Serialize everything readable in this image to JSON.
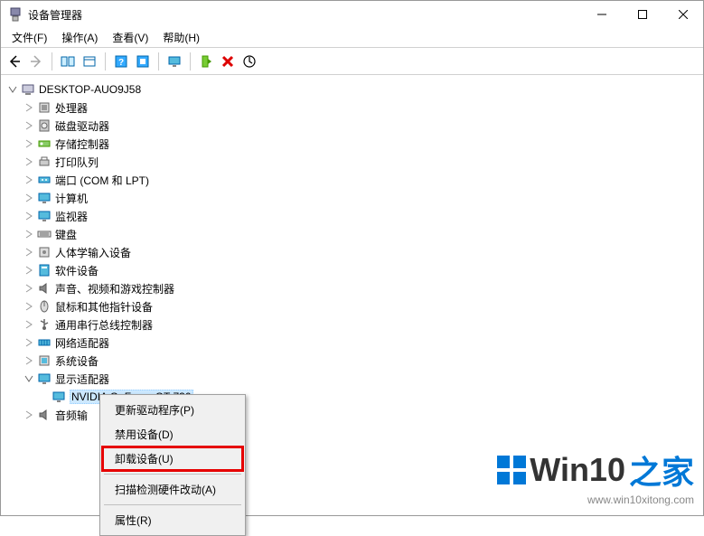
{
  "window": {
    "title": "设备管理器",
    "minimize": "–",
    "maximize": "☐",
    "close": "✕"
  },
  "menubar": {
    "file": "文件(F)",
    "action": "操作(A)",
    "view": "查看(V)",
    "help": "帮助(H)"
  },
  "toolbar_icons": {
    "back": "back-icon",
    "forward": "forward-icon",
    "mmc": "mmc-icon",
    "view": "view-icon",
    "help": "help-icon",
    "scan": "scan-icon",
    "monitor": "monitor-icon",
    "enable": "enable-icon",
    "delete": "delete-icon",
    "refresh": "refresh-icon"
  },
  "tree": {
    "root": "DESKTOP-AUO9J58",
    "items": [
      {
        "label": "处理器",
        "icon": "cpu"
      },
      {
        "label": "磁盘驱动器",
        "icon": "disk"
      },
      {
        "label": "存储控制器",
        "icon": "storage"
      },
      {
        "label": "打印队列",
        "icon": "printer"
      },
      {
        "label": "端口 (COM 和 LPT)",
        "icon": "port"
      },
      {
        "label": "计算机",
        "icon": "computer"
      },
      {
        "label": "监视器",
        "icon": "monitor"
      },
      {
        "label": "键盘",
        "icon": "keyboard"
      },
      {
        "label": "人体学输入设备",
        "icon": "hid"
      },
      {
        "label": "软件设备",
        "icon": "soft"
      },
      {
        "label": "声音、视频和游戏控制器",
        "icon": "sound"
      },
      {
        "label": "鼠标和其他指针设备",
        "icon": "mouse"
      },
      {
        "label": "通用串行总线控制器",
        "icon": "usb"
      },
      {
        "label": "网络适配器",
        "icon": "net"
      },
      {
        "label": "系统设备",
        "icon": "sys"
      }
    ],
    "display_adapters": {
      "label": "显示适配器",
      "child": "NVIDIA GeForce GT 730"
    },
    "audio": {
      "label": "音频输"
    }
  },
  "context_menu": {
    "update": "更新驱动程序(P)",
    "disable": "禁用设备(D)",
    "uninstall": "卸载设备(U)",
    "scan": "扫描检测硬件改动(A)",
    "props": "属性(R)"
  },
  "watermark": {
    "brand_prefix": "Win10",
    "brand_suffix": "之家",
    "url": "www.win10xitong.com"
  }
}
